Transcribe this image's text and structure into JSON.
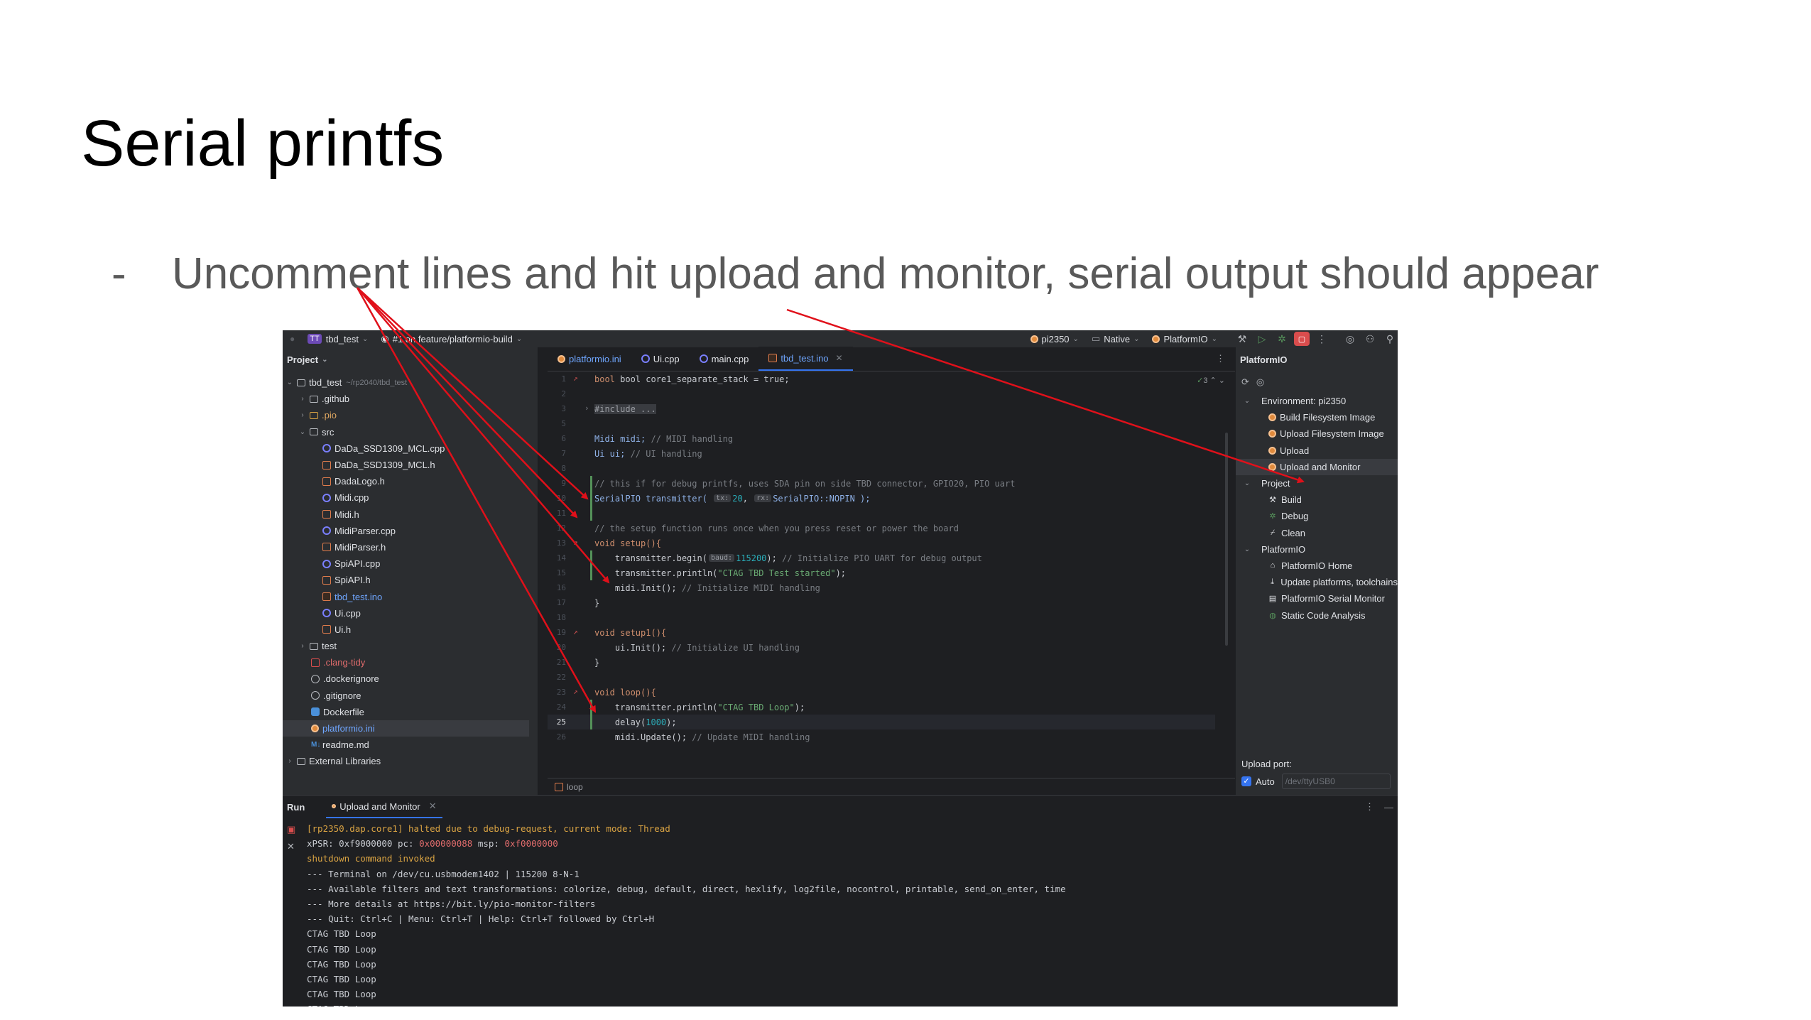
{
  "slide": {
    "title": "Serial printfs",
    "bullet_marker": "-",
    "bullet_text": "Uncomment lines and hit upload and monitor, serial output should appear",
    "arrow_color": "#e0101a"
  },
  "titlebar": {
    "project_badge": "TT",
    "project_name": "tbd_test",
    "branch": "#1 on feature/platformio-build",
    "env": "pi2350",
    "toolchain": "Native",
    "run_config": "PlatformIO"
  },
  "project_panel": {
    "header": "Project",
    "root_name": "tbd_test",
    "root_path": "~/rp2040/tbd_test",
    "items": {
      "github": ".github",
      "pio": ".pio",
      "src": "src",
      "f1": "DaDa_SSD1309_MCL.cpp",
      "f2": "DaDa_SSD1309_MCL.h",
      "f3": "DadaLogo.h",
      "f4": "Midi.cpp",
      "f5": "Midi.h",
      "f6": "MidiParser.cpp",
      "f7": "MidiParser.h",
      "f8": "SpiAPI.cpp",
      "f9": "SpiAPI.h",
      "f10": "tbd_test.ino",
      "f11": "Ui.cpp",
      "f12": "Ui.h",
      "test": "test",
      "clang": ".clang-tidy",
      "dockerignore": ".dockerignore",
      "gitignore": ".gitignore",
      "dockerfile": "Dockerfile",
      "platformio": "platformio.ini",
      "readme": "readme.md",
      "external": "External Libraries"
    }
  },
  "editor": {
    "tabs": [
      "platformio.ini",
      "Ui.cpp",
      "main.cpp",
      "tbd_test.ino"
    ],
    "inspection_count": "3",
    "breadcrumb": "loop",
    "line_numbers": [
      "1",
      "2",
      "3",
      "5",
      "6",
      "7",
      "8",
      "9",
      "10",
      "11",
      "12",
      "13",
      "14",
      "15",
      "16",
      "17",
      "18",
      "19",
      "20",
      "21",
      "22",
      "23",
      "24",
      "25",
      "26"
    ],
    "code": {
      "l1": "bool core1_separate_stack = true;",
      "l3": "#include ...",
      "l6a": "Midi midi; ",
      "l6b": "// MIDI handling",
      "l7a": "Ui ui; ",
      "l7b": "// UI handling",
      "l9": "// this if for debug printfs, uses SDA pin on side TBD connector, GPIO20, PIO uart",
      "l10a": "SerialPIO transmitter( ",
      "l10hint": "tx:",
      "l10num": "20",
      "l10hint2": "rx:",
      "l10b": "SerialPIO::NOPIN );",
      "l12": "// the setup function runs once when you press reset or power the board",
      "l13": "void setup(){",
      "l14a": "    transmitter.begin(",
      "l14hint": "baud:",
      "l14num": "115200",
      "l14b": "); ",
      "l14c": "// Initialize PIO UART for debug output",
      "l15a": "    transmitter.println(",
      "l15s": "\"CTAG TBD Test started\"",
      "l15b": ");",
      "l16a": "    midi.Init(); ",
      "l16b": "// Initialize MIDI handling",
      "l17": "}",
      "l19": "void setup1(){",
      "l20a": "    ui.Init(); ",
      "l20b": "// Initialize UI handling",
      "l21": "}",
      "l23": "void loop(){",
      "l24a": "    transmitter.println(",
      "l24s": "\"CTAG TBD Loop\"",
      "l24b": ");",
      "l25a": "    delay(",
      "l25n": "1000",
      "l25b": ");",
      "l26a": "    midi.Update(); ",
      "l26b": "// Update MIDI handling"
    }
  },
  "pio_panel": {
    "header": "PlatformIO",
    "env_label": "Environment: pi2350",
    "env_tasks": [
      "Build Filesystem Image",
      "Upload Filesystem Image",
      "Upload",
      "Upload and Monitor"
    ],
    "project_label": "Project",
    "project_tasks": [
      "Build",
      "Debug",
      "Clean"
    ],
    "platformio_label": "PlatformIO",
    "platformio_tasks": [
      "PlatformIO Home",
      "Update platforms, toolchains",
      "PlatformIO Serial Monitor",
      "Static Code Analysis"
    ],
    "upload_port_label": "Upload port:",
    "auto_label": "Auto",
    "port_placeholder": "/dev/ttyUSB0"
  },
  "run_panel": {
    "label": "Run",
    "tab": "Upload and Monitor",
    "output": [
      {
        "text": "[rp2350.dap.core1] halted due to debug-request, current mode: Thread",
        "style": "orange"
      },
      {
        "text": "xPSR: 0xf9000000 pc: 0x00000088 msp: 0xf0000000",
        "style": "mixed"
      },
      {
        "text": "shutdown command invoked",
        "style": "orange"
      },
      {
        "text": "--- Terminal on /dev/cu.usbmodem1402 | 115200 8-N-1",
        "style": "normal"
      },
      {
        "text": "--- Available filters and text transformations: colorize, debug, default, direct, hexlify, log2file, nocontrol, printable, send_on_enter, time",
        "style": "normal"
      },
      {
        "text": "--- More details at https://bit.ly/pio-monitor-filters",
        "style": "normal"
      },
      {
        "text": "--- Quit: Ctrl+C | Menu: Ctrl+T | Help: Ctrl+T followed by Ctrl+H",
        "style": "normal"
      },
      {
        "text": "CTAG TBD Loop",
        "style": "normal"
      },
      {
        "text": "CTAG TBD Loop",
        "style": "normal"
      },
      {
        "text": "CTAG TBD Loop",
        "style": "normal"
      },
      {
        "text": "CTAG TBD Loop",
        "style": "normal"
      },
      {
        "text": "CTAG TBD Loop",
        "style": "normal"
      },
      {
        "text": "CTAG TBD Loop",
        "style": "normal"
      }
    ]
  }
}
